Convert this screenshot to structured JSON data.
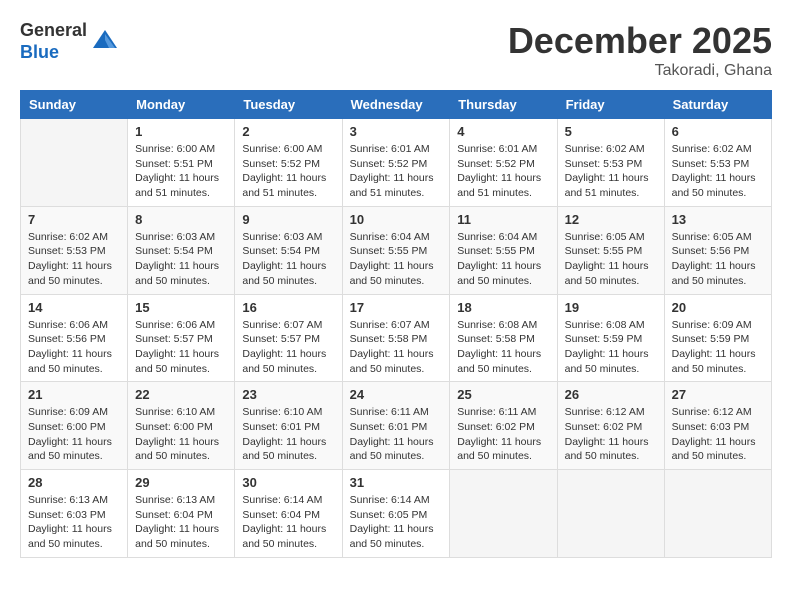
{
  "logo": {
    "general": "General",
    "blue": "Blue"
  },
  "title": "December 2025",
  "location": "Takoradi, Ghana",
  "days_of_week": [
    "Sunday",
    "Monday",
    "Tuesday",
    "Wednesday",
    "Thursday",
    "Friday",
    "Saturday"
  ],
  "weeks": [
    [
      {
        "day": "",
        "info": ""
      },
      {
        "day": "1",
        "info": "Sunrise: 6:00 AM\nSunset: 5:51 PM\nDaylight: 11 hours\nand 51 minutes."
      },
      {
        "day": "2",
        "info": "Sunrise: 6:00 AM\nSunset: 5:52 PM\nDaylight: 11 hours\nand 51 minutes."
      },
      {
        "day": "3",
        "info": "Sunrise: 6:01 AM\nSunset: 5:52 PM\nDaylight: 11 hours\nand 51 minutes."
      },
      {
        "day": "4",
        "info": "Sunrise: 6:01 AM\nSunset: 5:52 PM\nDaylight: 11 hours\nand 51 minutes."
      },
      {
        "day": "5",
        "info": "Sunrise: 6:02 AM\nSunset: 5:53 PM\nDaylight: 11 hours\nand 51 minutes."
      },
      {
        "day": "6",
        "info": "Sunrise: 6:02 AM\nSunset: 5:53 PM\nDaylight: 11 hours\nand 50 minutes."
      }
    ],
    [
      {
        "day": "7",
        "info": "Sunrise: 6:02 AM\nSunset: 5:53 PM\nDaylight: 11 hours\nand 50 minutes."
      },
      {
        "day": "8",
        "info": "Sunrise: 6:03 AM\nSunset: 5:54 PM\nDaylight: 11 hours\nand 50 minutes."
      },
      {
        "day": "9",
        "info": "Sunrise: 6:03 AM\nSunset: 5:54 PM\nDaylight: 11 hours\nand 50 minutes."
      },
      {
        "day": "10",
        "info": "Sunrise: 6:04 AM\nSunset: 5:55 PM\nDaylight: 11 hours\nand 50 minutes."
      },
      {
        "day": "11",
        "info": "Sunrise: 6:04 AM\nSunset: 5:55 PM\nDaylight: 11 hours\nand 50 minutes."
      },
      {
        "day": "12",
        "info": "Sunrise: 6:05 AM\nSunset: 5:55 PM\nDaylight: 11 hours\nand 50 minutes."
      },
      {
        "day": "13",
        "info": "Sunrise: 6:05 AM\nSunset: 5:56 PM\nDaylight: 11 hours\nand 50 minutes."
      }
    ],
    [
      {
        "day": "14",
        "info": "Sunrise: 6:06 AM\nSunset: 5:56 PM\nDaylight: 11 hours\nand 50 minutes."
      },
      {
        "day": "15",
        "info": "Sunrise: 6:06 AM\nSunset: 5:57 PM\nDaylight: 11 hours\nand 50 minutes."
      },
      {
        "day": "16",
        "info": "Sunrise: 6:07 AM\nSunset: 5:57 PM\nDaylight: 11 hours\nand 50 minutes."
      },
      {
        "day": "17",
        "info": "Sunrise: 6:07 AM\nSunset: 5:58 PM\nDaylight: 11 hours\nand 50 minutes."
      },
      {
        "day": "18",
        "info": "Sunrise: 6:08 AM\nSunset: 5:58 PM\nDaylight: 11 hours\nand 50 minutes."
      },
      {
        "day": "19",
        "info": "Sunrise: 6:08 AM\nSunset: 5:59 PM\nDaylight: 11 hours\nand 50 minutes."
      },
      {
        "day": "20",
        "info": "Sunrise: 6:09 AM\nSunset: 5:59 PM\nDaylight: 11 hours\nand 50 minutes."
      }
    ],
    [
      {
        "day": "21",
        "info": "Sunrise: 6:09 AM\nSunset: 6:00 PM\nDaylight: 11 hours\nand 50 minutes."
      },
      {
        "day": "22",
        "info": "Sunrise: 6:10 AM\nSunset: 6:00 PM\nDaylight: 11 hours\nand 50 minutes."
      },
      {
        "day": "23",
        "info": "Sunrise: 6:10 AM\nSunset: 6:01 PM\nDaylight: 11 hours\nand 50 minutes."
      },
      {
        "day": "24",
        "info": "Sunrise: 6:11 AM\nSunset: 6:01 PM\nDaylight: 11 hours\nand 50 minutes."
      },
      {
        "day": "25",
        "info": "Sunrise: 6:11 AM\nSunset: 6:02 PM\nDaylight: 11 hours\nand 50 minutes."
      },
      {
        "day": "26",
        "info": "Sunrise: 6:12 AM\nSunset: 6:02 PM\nDaylight: 11 hours\nand 50 minutes."
      },
      {
        "day": "27",
        "info": "Sunrise: 6:12 AM\nSunset: 6:03 PM\nDaylight: 11 hours\nand 50 minutes."
      }
    ],
    [
      {
        "day": "28",
        "info": "Sunrise: 6:13 AM\nSunset: 6:03 PM\nDaylight: 11 hours\nand 50 minutes."
      },
      {
        "day": "29",
        "info": "Sunrise: 6:13 AM\nSunset: 6:04 PM\nDaylight: 11 hours\nand 50 minutes."
      },
      {
        "day": "30",
        "info": "Sunrise: 6:14 AM\nSunset: 6:04 PM\nDaylight: 11 hours\nand 50 minutes."
      },
      {
        "day": "31",
        "info": "Sunrise: 6:14 AM\nSunset: 6:05 PM\nDaylight: 11 hours\nand 50 minutes."
      },
      {
        "day": "",
        "info": ""
      },
      {
        "day": "",
        "info": ""
      },
      {
        "day": "",
        "info": ""
      }
    ]
  ]
}
